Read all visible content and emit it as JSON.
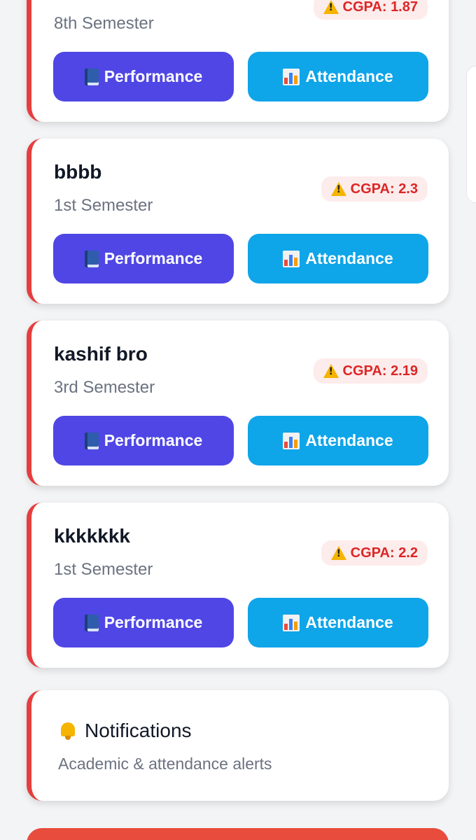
{
  "students": [
    {
      "name": "",
      "semester": "8th Semester",
      "cgpa": "CGPA: 1.87"
    },
    {
      "name": "bbbb",
      "semester": "1st Semester",
      "cgpa": "CGPA: 2.3"
    },
    {
      "name": "kashif bro",
      "semester": "3rd Semester",
      "cgpa": "CGPA: 2.19"
    },
    {
      "name": "kkkkkkk",
      "semester": "1st Semester",
      "cgpa": "CGPA: 2.2"
    }
  ],
  "buttons": {
    "performance_label": "Performance",
    "attendance_label": "Attendance"
  },
  "notifications": {
    "title": "Notifications",
    "subtitle": "Academic & attendance alerts"
  },
  "colors": {
    "card_accent": "#e53e3e",
    "performance_button": "#4f46e5",
    "attendance_button": "#0ea5e9",
    "cgpa_text": "#dc2626",
    "cgpa_badge_bg": "#fdecec"
  },
  "icons": {
    "performance": "book-icon",
    "attendance": "bar-chart-icon",
    "cgpa": "warning-icon",
    "notifications": "bell-icon"
  }
}
